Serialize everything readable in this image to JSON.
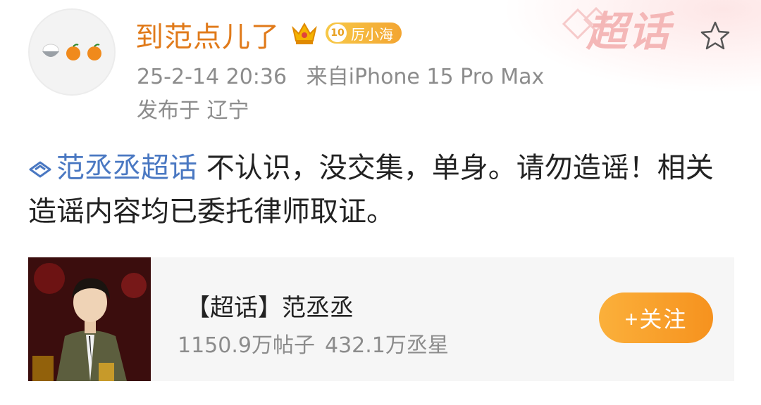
{
  "post": {
    "author": {
      "name": "到范点儿了",
      "fan_badge": {
        "level": "10",
        "label": "厉小海"
      }
    },
    "timestamp": "25-2-14 20:36",
    "source": "来自iPhone 15 Pro Max",
    "location": "发布于 辽宁",
    "content": {
      "topic": "范丞丞超话",
      "text": " 不认识，没交集，单身。请勿造谣！相关造谣内容均已委托律师取证。"
    },
    "watermark": "超话"
  },
  "supertopic_card": {
    "title": "【超话】范丞丞",
    "posts": "1150.9万帖子",
    "members": "432.1万丞星",
    "follow_label": "+关注"
  },
  "colors": {
    "username": "#e07a1a",
    "link": "#4a78c2",
    "meta": "#8c8c8c",
    "follow_button": "#f6921e"
  },
  "icons": [
    "avatar-emoji",
    "crown-icon",
    "fan-badge",
    "star-icon",
    "supertopic-diamond-icon"
  ]
}
